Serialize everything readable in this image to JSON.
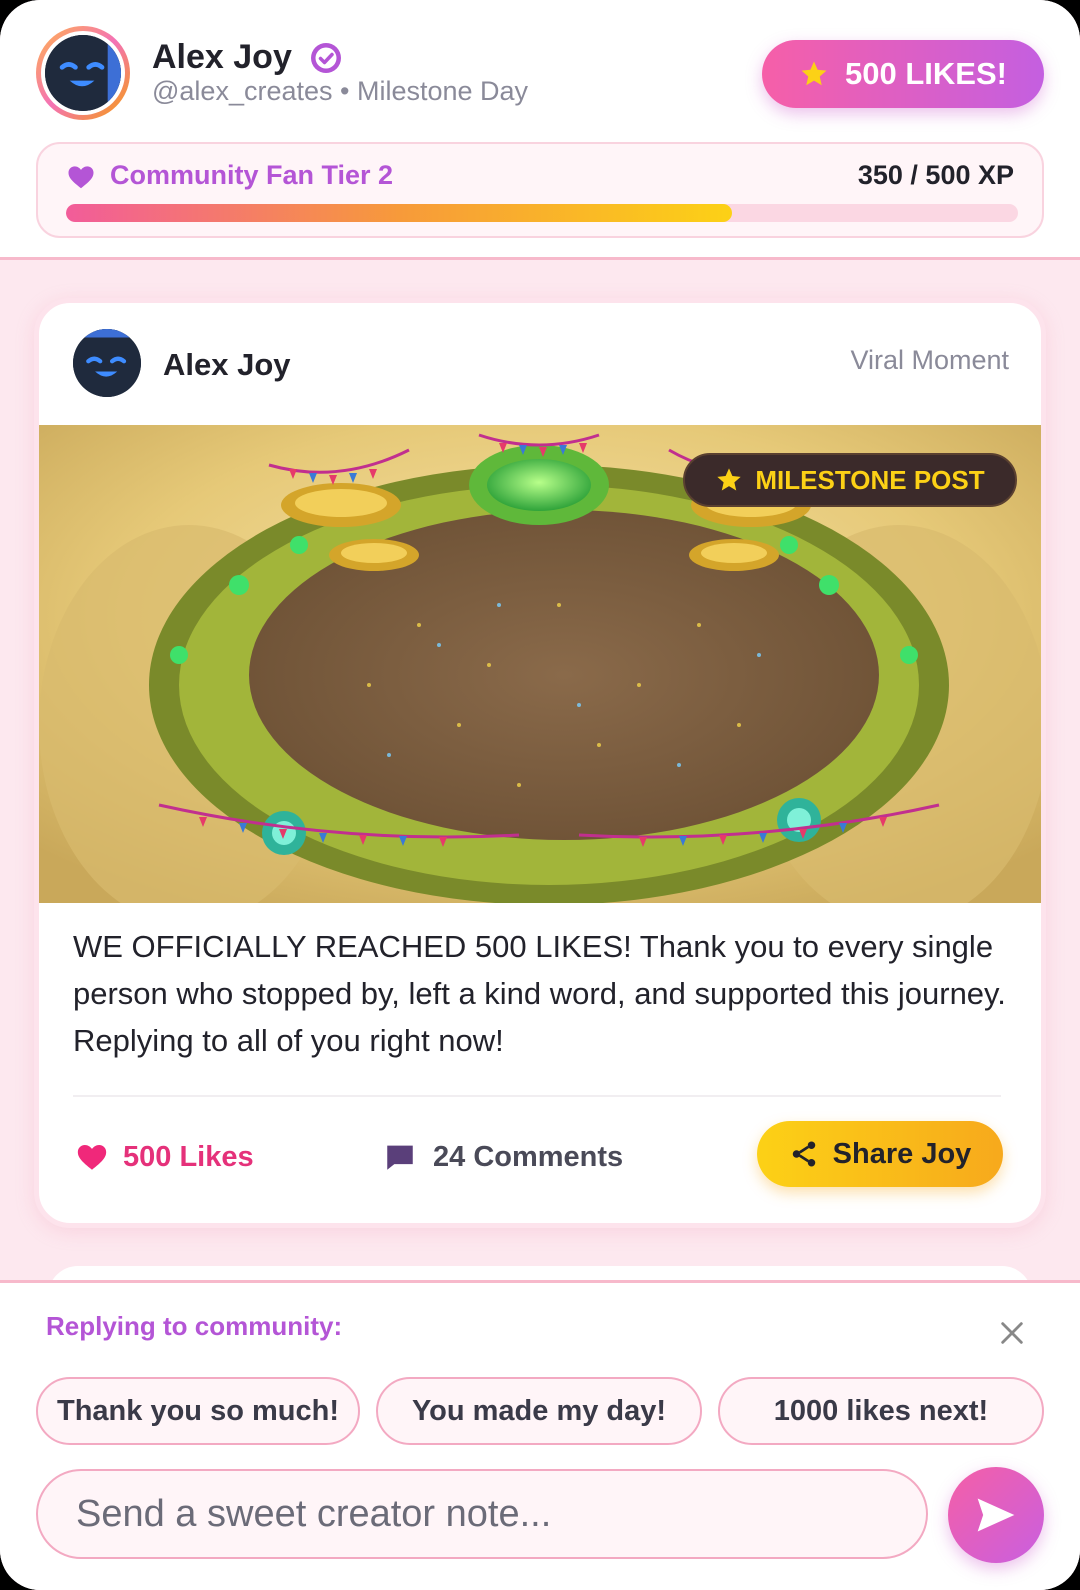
{
  "profile": {
    "name": "Alex Joy",
    "handle_line": "@alex_creates • Milestone Day",
    "likes_badge": "500 LIKES!"
  },
  "xp": {
    "tier_label": "Community Fan Tier 2",
    "value_label": "350 / 500 XP",
    "progress": 0.7
  },
  "post": {
    "author": "Alex Joy",
    "tag": "Viral Moment",
    "badge": "MILESTONE POST",
    "text": "WE OFFICIALLY REACHED 500 LIKES! Thank you to every single person who stopped by, left a kind word, and supported this journey. Replying to all of you right now!",
    "likes_label": "500 Likes",
    "comments_label": "24 Comments",
    "share_label": "Share Joy"
  },
  "reply": {
    "label": "Replying to community:",
    "suggestions": [
      "Thank you so much!",
      "You made my day!",
      "1000 likes next!"
    ],
    "placeholder": "Send a sweet creator note..."
  },
  "colors": {
    "accent_pink": "#f65fa8",
    "accent_purple": "#b455d6",
    "accent_gold": "#fcd116",
    "like_red": "#e5317a"
  },
  "icons": [
    "verified-icon",
    "star-icon",
    "heart-icon",
    "comment-icon",
    "share-icon",
    "close-icon",
    "send-icon"
  ]
}
